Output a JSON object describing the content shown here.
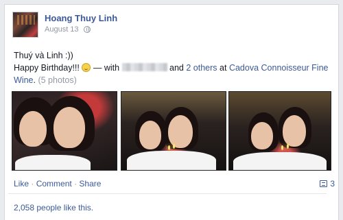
{
  "post": {
    "author": "Hoang Thuy Linh",
    "date": "August 13",
    "privacy_icon": "globe-icon",
    "line1": "Thuý và Linh :))",
    "line2_start": "Happy Birthday!!!",
    "emoticon": "smile-icon",
    "with_text": "— with",
    "and_text": "and",
    "others_link": "2 others",
    "at_text": "at",
    "place_link": "Cadova Connoisseur Fine Wine",
    "period": ".",
    "photos_count": "(5 photos)"
  },
  "actions": {
    "like": "Like",
    "separator": "·",
    "comment": "Comment",
    "share": "Share",
    "comment_count": "3",
    "comment_icon": "comment-icon"
  },
  "likes_text": "2,058 people like this.",
  "colors": {
    "link": "#3b5998",
    "muted": "#9197a3",
    "background": "#e9ebee"
  }
}
